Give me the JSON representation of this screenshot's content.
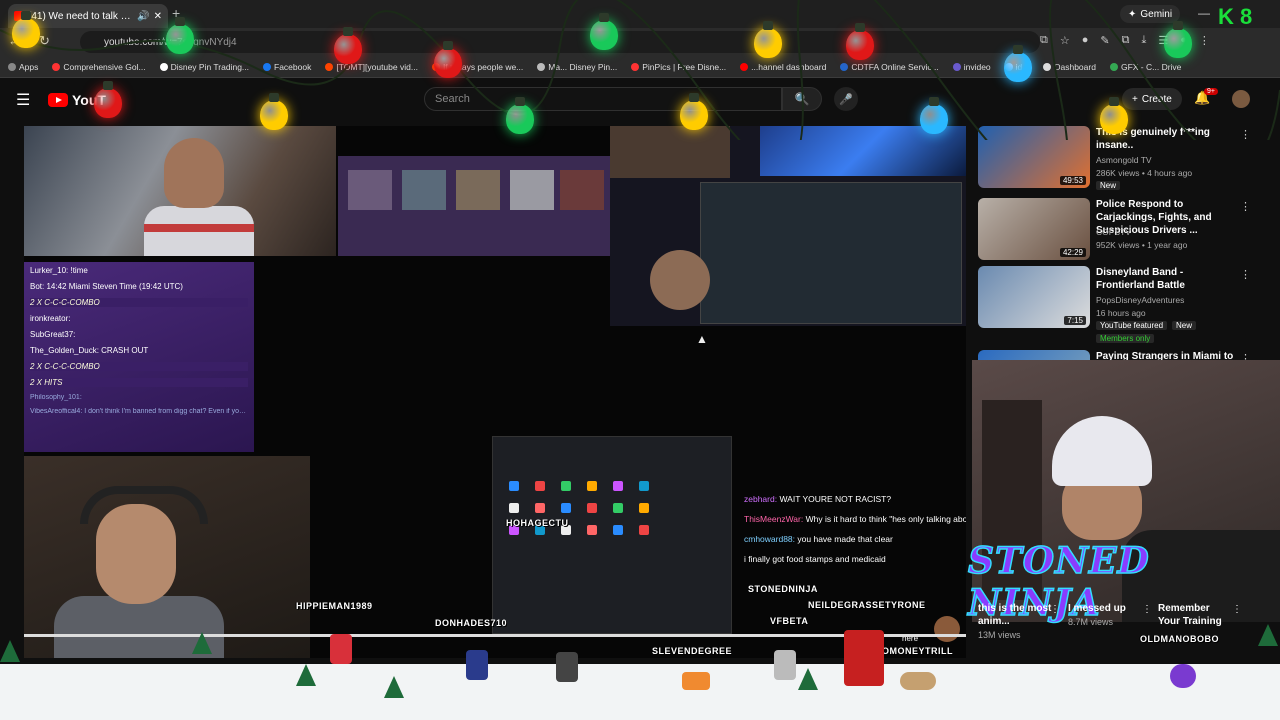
{
  "browser": {
    "tab_title": "(41) We need to talk about",
    "new_tab": "+",
    "gemini_label": "Gemini",
    "minimize": "—",
    "url_host": "youtube.com/w",
    "url_rest": "=7s7gnvNYdj4",
    "bookmarks": [
      {
        "label": "Apps",
        "color": "#888888"
      },
      {
        "label": "Comprehensive Gol...",
        "color": "#ff3333"
      },
      {
        "label": "Disney Pin Trading...",
        "color": "#ffffff"
      },
      {
        "label": "Facebook",
        "color": "#1877f2"
      },
      {
        "label": "[TOMT][youtube vid...",
        "color": "#ff4500"
      },
      {
        "label": "If todays people we...",
        "color": "#ff4500"
      },
      {
        "label": "Ma... Disney Pin...",
        "color": "#bbbbbb"
      },
      {
        "label": "PinPics | Free Disne...",
        "color": "#ff3333"
      },
      {
        "label": "...hannel dashboard",
        "color": "#ff0000"
      },
      {
        "label": "CDTFA Online Servic...",
        "color": "#2266cc"
      },
      {
        "label": "invideo",
        "color": "#6a5acd"
      },
      {
        "label": "id...",
        "color": "#4aa0ff"
      },
      {
        "label": "Dashboard",
        "color": "#dddddd"
      },
      {
        "label": "GFX - C... Drive",
        "color": "#34a853"
      }
    ]
  },
  "youtube": {
    "logo_text": "YouT",
    "search_placeholder": "Search",
    "create_label": "Create",
    "notif_count": "9+"
  },
  "stream": {
    "chat_lines": [
      "Lurker_10: !time",
      "Bot: 14:42 Miami Steven Time (19:42 UTC)",
      "2 X C-C-C-COMBO",
      "ironkreator:",
      "SubGreat37:",
      "The_Golden_Duck: CRASH OUT",
      "2 X C-C-C-COMBO",
      "2 X HITS",
      "Philosophy_101:",
      "VibesAreoffical4: I don't think I'm banned from digg chat? Even if you think I couldn't load up some socks and ban evade?"
    ],
    "overlay_chat": [
      {
        "user": "zebhard:",
        "msg": "WAIT YOURE NOT RACIST?"
      },
      {
        "user": "ThisMeenzWar:",
        "msg": "Why is it hard to think \"hes only talking about the bad ones\""
      },
      {
        "user": "cmhoward88:",
        "msg": "you have made that clear"
      },
      {
        "user": "",
        "msg": "i finally got food stamps and medicaid"
      }
    ],
    "tags": {
      "hohagectu": "HOHAGECTU",
      "hippieman": "HIPPIEMAN1989",
      "donhades": "DONHADES710",
      "stoneninja": "STONEDNINJA",
      "neil": "NEILDEGRASSETYRONE",
      "vfbeta": "VFBETA",
      "eleven": "SLEVENDEGREE",
      "omoney": "OMONEYTRILL",
      "oldman": "OLDMANOBOBO",
      "here": "here"
    }
  },
  "sidebar": {
    "recs": [
      {
        "title": "This is genuinely f***ing insane..",
        "channel": "Asmongold TV",
        "meta": "286K views • 4 hours ago",
        "badge": "New",
        "duration": "49:53"
      },
      {
        "title": "Police Respond to Carjackings, Fights, and Suspicious Drivers ...",
        "channel": "COPSTV",
        "meta": "952K views • 1 year ago",
        "badge": "",
        "duration": "42:29"
      },
      {
        "title": "Disneyland Band - Frontierland Battle",
        "channel": "PopsDisneyAdventures",
        "meta": "16 hours ago",
        "badge": "YouTube featured",
        "badge2": "New",
        "members": "Members only",
        "duration": "7:15"
      },
      {
        "title": "Paying Strangers in Miami to",
        "channel": "",
        "meta": "",
        "badge": "",
        "duration": ""
      }
    ],
    "stoned_ninja": "STONED NINJA",
    "shorts": [
      {
        "title": "this is the most anim...",
        "views": "13M views"
      },
      {
        "title": "I messed up",
        "views": "8.7M views"
      },
      {
        "title": "Remember Your Training",
        "views": ""
      }
    ]
  },
  "corner_logo": {
    "k": "K",
    "num": "8"
  },
  "colors": {
    "accent": "#ff0000",
    "lights": [
      "#ffcc00",
      "#19c95a",
      "#e01818",
      "#2ab8ff"
    ]
  }
}
